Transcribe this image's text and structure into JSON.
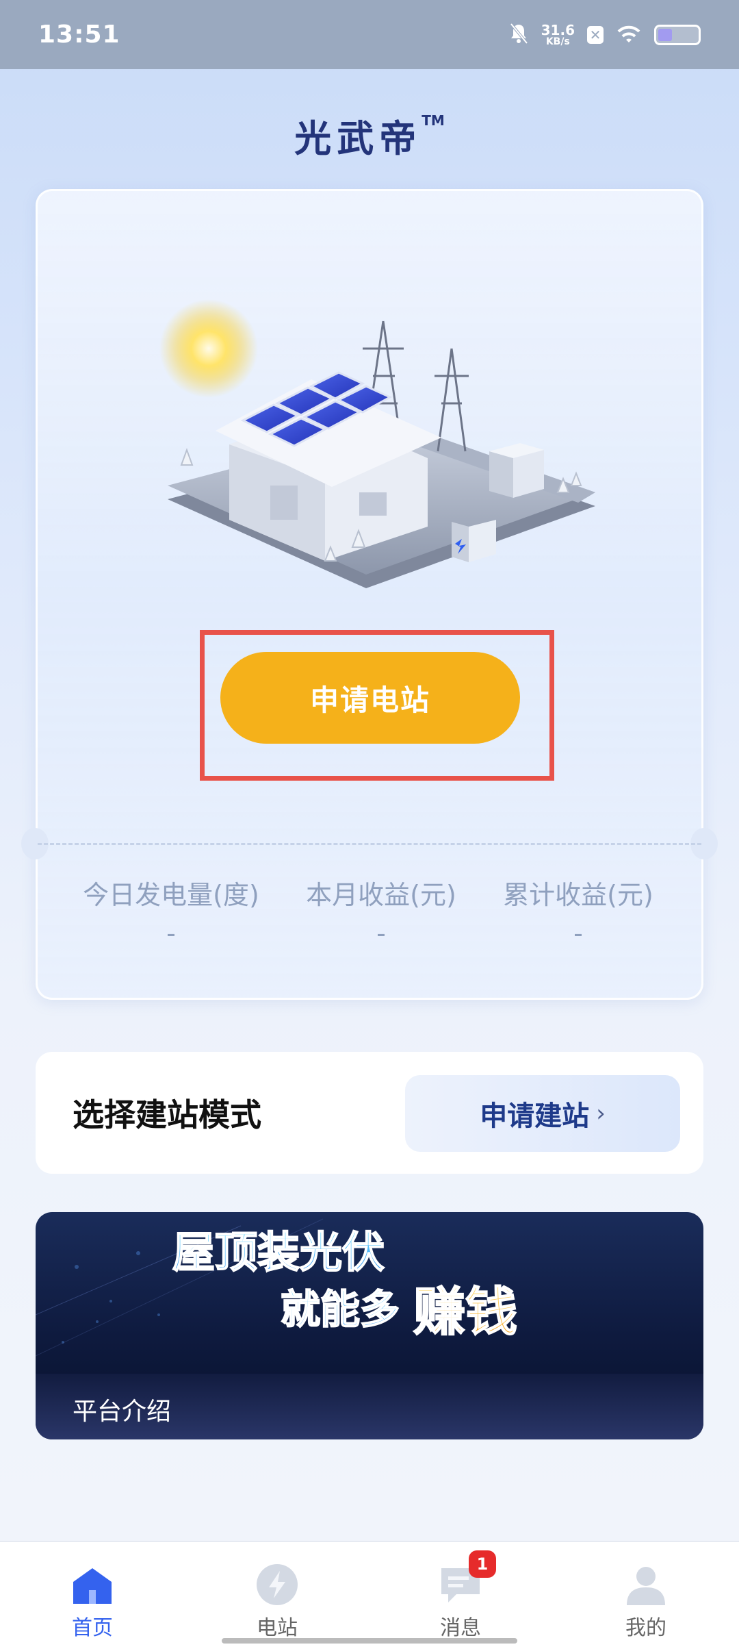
{
  "status_bar": {
    "time": "13:51",
    "net_speed_value": "31.6",
    "net_speed_unit": "KB/s",
    "battery_level": 0.35
  },
  "header": {
    "brand": "光武帝",
    "trademark": "TM"
  },
  "hero": {
    "apply_button": "申请电站",
    "stats": [
      {
        "label": "今日发电量(度)",
        "value": "-"
      },
      {
        "label": "本月收益(元)",
        "value": "-"
      },
      {
        "label": "累计收益(元)",
        "value": "-"
      }
    ]
  },
  "mode_card": {
    "title": "选择建站模式",
    "button": "申请建站",
    "chevron": "›"
  },
  "banner": {
    "line1": "屋顶装光伏",
    "line2a": "就能多",
    "line2b": "赚钱",
    "footer": "平台介绍"
  },
  "tabbar": {
    "items": [
      {
        "label": "首页",
        "icon": "home-icon",
        "active": true
      },
      {
        "label": "电站",
        "icon": "bolt-icon",
        "active": false
      },
      {
        "label": "消息",
        "icon": "message-icon",
        "active": false,
        "badge": "1"
      },
      {
        "label": "我的",
        "icon": "user-icon",
        "active": false
      }
    ]
  },
  "colors": {
    "accent_blue": "#3462ee",
    "apply_orange": "#f5b11a",
    "highlight_red": "#e8524a",
    "brand_navy": "#23347a"
  }
}
